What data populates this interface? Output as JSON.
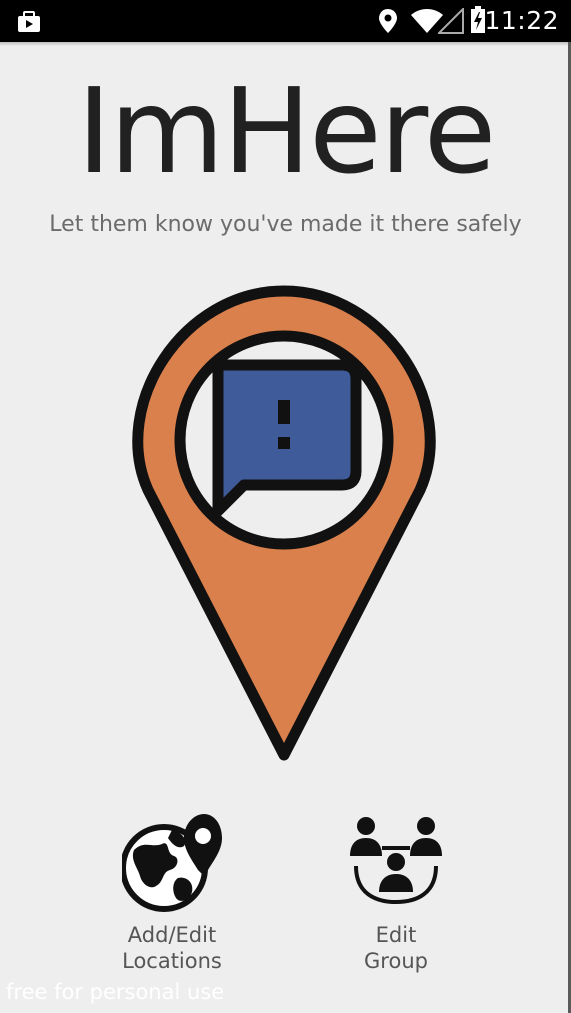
{
  "status_bar": {
    "time": "11:22",
    "icons": [
      "screenshot-icon",
      "location-icon",
      "wifi-icon",
      "signal-icon",
      "battery-charging-icon"
    ]
  },
  "app": {
    "title": "ImHere",
    "subtitle": "Let them know you've made it there safely"
  },
  "logo": {
    "icon": "map-pin-chat-icon",
    "colors": {
      "pin": "#d9804d",
      "bubble": "#3f5b99",
      "outline": "#111111",
      "inner": "#eeeeee"
    }
  },
  "actions": [
    {
      "icon": "globe-pin-icon",
      "line1": "Add/Edit",
      "line2": "Locations"
    },
    {
      "icon": "group-icon",
      "line1": "Edit",
      "line2": "Group"
    }
  ],
  "watermark": "free for personal use"
}
